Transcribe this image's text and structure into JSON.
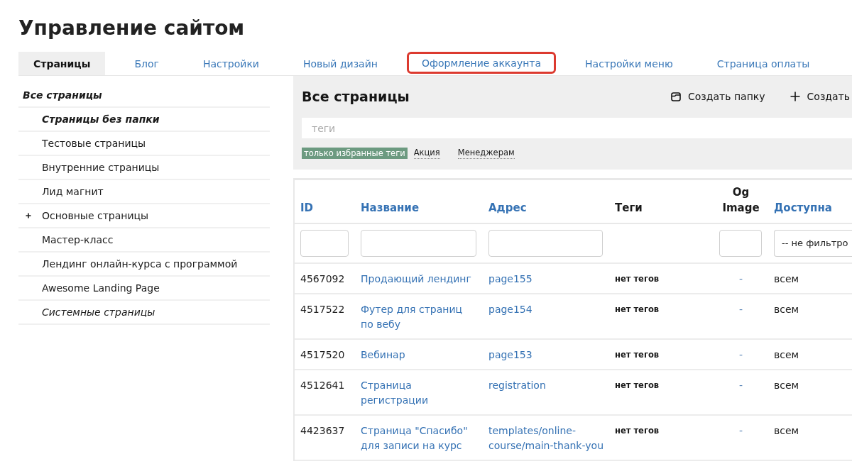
{
  "page": {
    "title": "Управление сайтом"
  },
  "tabs": [
    {
      "label": "Страницы",
      "selected": true,
      "highlighted": false
    },
    {
      "label": "Блог",
      "selected": false,
      "highlighted": false
    },
    {
      "label": "Настройки",
      "selected": false,
      "highlighted": false
    },
    {
      "label": "Новый дизайн",
      "selected": false,
      "highlighted": false
    },
    {
      "label": "Оформление аккаунта",
      "selected": false,
      "highlighted": true
    },
    {
      "label": "Настройки меню",
      "selected": false,
      "highlighted": false
    },
    {
      "label": "Страница оплаты",
      "selected": false,
      "highlighted": false
    }
  ],
  "sidebar": {
    "items": [
      {
        "label": "Все страницы",
        "kind": "virtual",
        "collapsed": false,
        "children": [
          {
            "label": "Страницы без папки",
            "kind": "virtual",
            "collapsed": false
          },
          {
            "label": "Тестовые страницы",
            "kind": "folder",
            "collapsed": false
          },
          {
            "label": "Внутренние страницы",
            "kind": "folder",
            "collapsed": false
          },
          {
            "label": "Лид магнит",
            "kind": "folder",
            "collapsed": false
          },
          {
            "label": "Основные страницы",
            "kind": "folder",
            "collapsed": true
          },
          {
            "label": "Мастер-класс",
            "kind": "folder",
            "collapsed": false
          },
          {
            "label": "Лендинг онлайн-курса с программой",
            "kind": "folder",
            "collapsed": false
          },
          {
            "label": "Awesome Landing Page",
            "kind": "folder",
            "collapsed": false
          },
          {
            "label": "Системные страницы",
            "kind": "system",
            "collapsed": false
          }
        ]
      }
    ]
  },
  "main": {
    "heading": "Все страницы",
    "actions": [
      {
        "label": "Создать папку",
        "kind": "folder"
      },
      {
        "label": "Создать",
        "kind": "add"
      }
    ],
    "tag_filter": {
      "placeholder": "теги",
      "favorites_only": {
        "label": "только избранные теги",
        "on": true
      },
      "tags": [
        {
          "label": "Акция"
        },
        {
          "label": "Менеджерам"
        }
      ]
    }
  },
  "table": {
    "columns": [
      {
        "label": "ID",
        "sortable": true,
        "filter": {
          "kind": "input"
        }
      },
      {
        "label": "Название",
        "sortable": true,
        "filter": {
          "kind": "input"
        }
      },
      {
        "label": "Адрес",
        "sortable": true,
        "filter": {
          "kind": "input"
        }
      },
      {
        "label": "Теги",
        "sortable": false
      },
      {
        "label": "Og Image",
        "sortable": false,
        "filter": {
          "kind": "input"
        }
      },
      {
        "label": "Доступна",
        "sortable": true,
        "filter": {
          "kind": "select",
          "value": "-- не фильтро"
        }
      }
    ],
    "rows": [
      {
        "id": "4567092",
        "name": "Продающий лендинг",
        "address": "page155",
        "tags": "нет тегов",
        "og_image": "-",
        "access": "всем"
      },
      {
        "id": "4517522",
        "name": "Футер для страниц по вебу",
        "address": "page154",
        "tags": "нет тегов",
        "og_image": "-",
        "access": "всем"
      },
      {
        "id": "4517520",
        "name": "Вебинар",
        "address": "page153",
        "tags": "нет тегов",
        "og_image": "-",
        "access": "всем"
      },
      {
        "id": "4512641",
        "name": "Страница регистрации",
        "address": "registration",
        "tags": "нет тегов",
        "og_image": "-",
        "access": "всем"
      },
      {
        "id": "4423637",
        "name": "Страница \"Спасибо\" для записи на курс",
        "address": "templates/online-course/main-thank-you",
        "tags": "нет тегов",
        "og_image": "-",
        "access": "всем"
      }
    ]
  }
}
